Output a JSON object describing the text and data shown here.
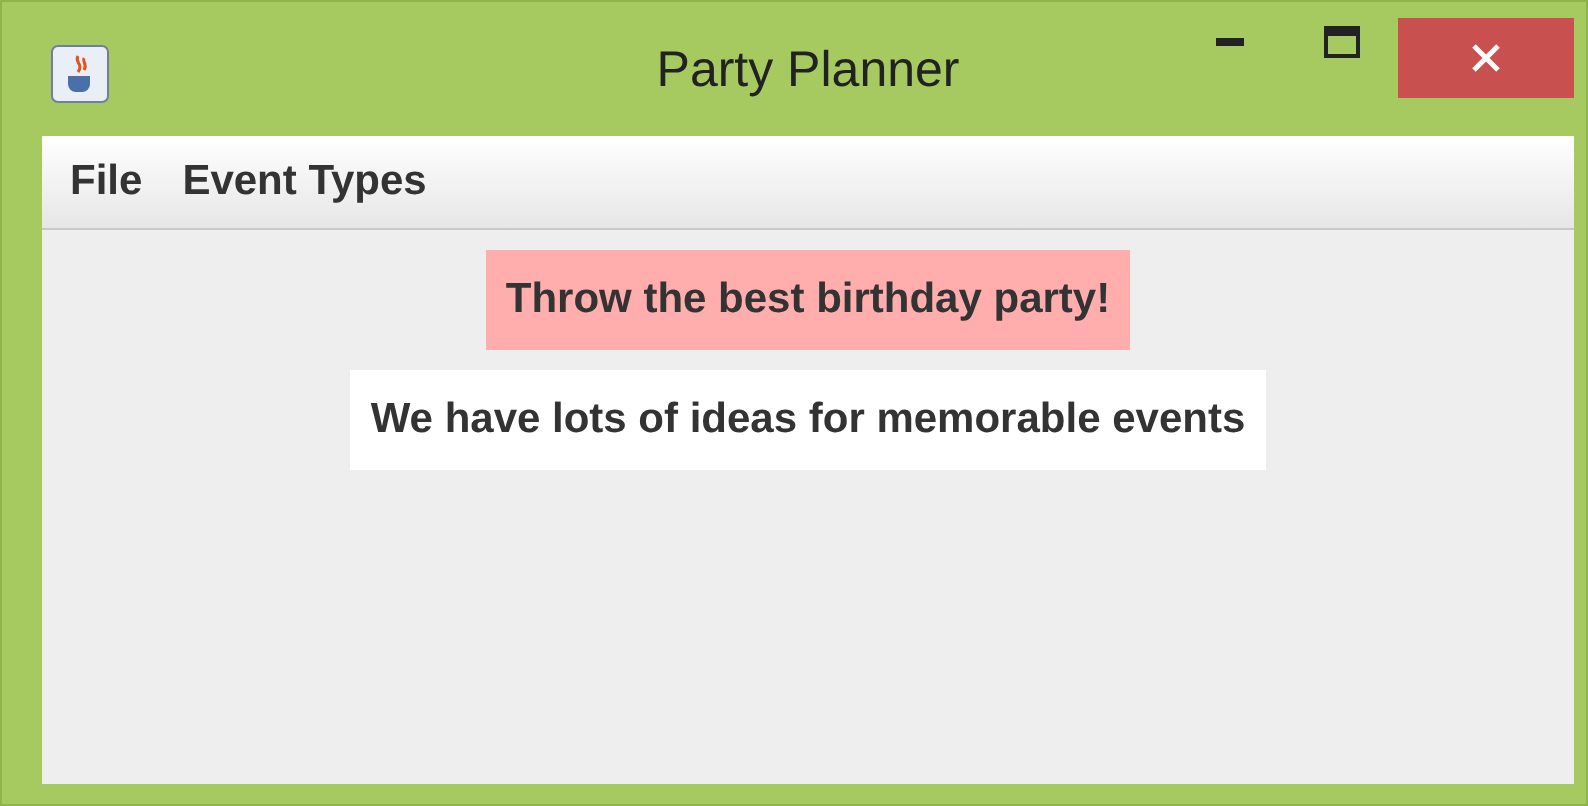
{
  "window": {
    "title": "Party Planner"
  },
  "menu": [
    {
      "label": "File"
    },
    {
      "label": "Event Types"
    }
  ],
  "labels": [
    {
      "text": "Throw the best birthday party!",
      "color": "#ffadad"
    },
    {
      "text": "We have lots of ideas for memorable events",
      "color": "#ffffff"
    }
  ]
}
